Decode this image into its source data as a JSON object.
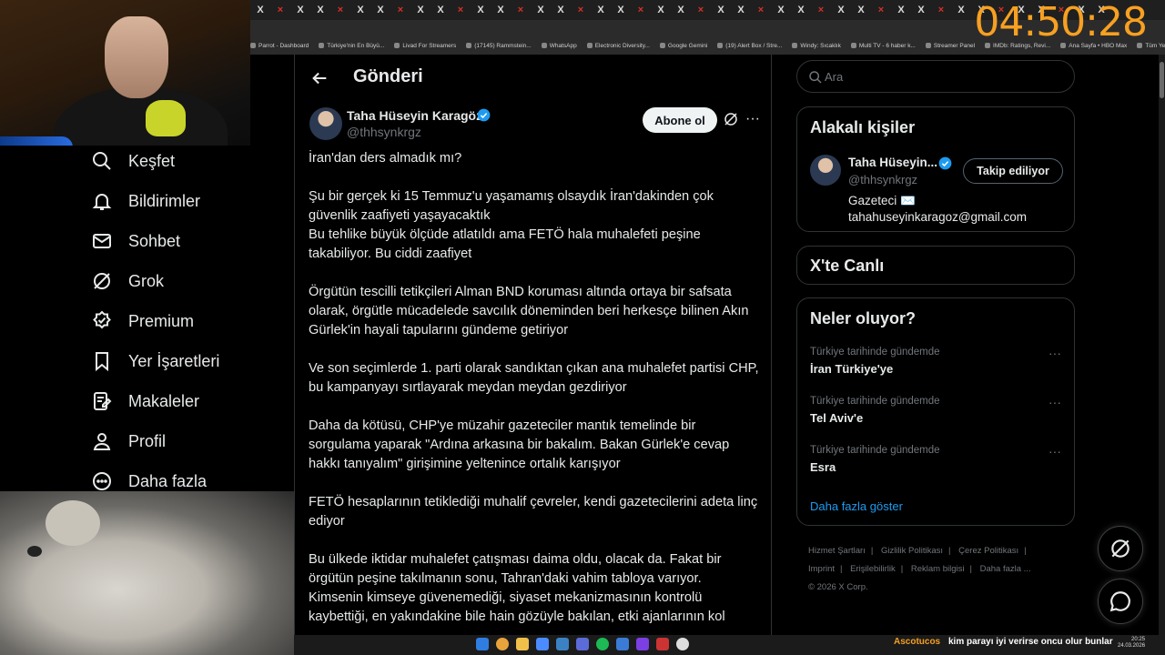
{
  "browser": {
    "tab_glyph": "X",
    "bookmarks": [
      "Parrot - Dashboard",
      "Türkiye'nin En Büyü...",
      "Livad For Streamers",
      "(17145) Rammstein...",
      "WhatsApp",
      "Electronic Diversity...",
      "Google Gemini",
      "(19) Alert Box / Stre...",
      "Windy: Sıcaklık",
      "Multi TV - 6 haber k...",
      "Streamer Panel",
      "IMDb: Ratings, Revi...",
      "Ana Sayfa • HBO Max",
      "Tüm Yer İşaretleri"
    ]
  },
  "overlay": {
    "clock": "04:50:28",
    "ticker_user": "Ascotucos",
    "ticker_message": "kim parayı iyi verirse oncu olur bunlar",
    "tray_time": "20:25",
    "tray_date": "24.03.2026"
  },
  "sidebar": {
    "items": [
      {
        "label": "Keşfet",
        "icon": "search-icon"
      },
      {
        "label": "Bildirimler",
        "icon": "bell-icon"
      },
      {
        "label": "Sohbet",
        "icon": "mail-icon"
      },
      {
        "label": "Grok",
        "icon": "grok-icon"
      },
      {
        "label": "Premium",
        "icon": "premium-icon"
      },
      {
        "label": "Yer İşaretleri",
        "icon": "bookmark-icon"
      },
      {
        "label": "Makaleler",
        "icon": "article-icon"
      },
      {
        "label": "Profil",
        "icon": "profile-icon"
      },
      {
        "label": "Daha fazla",
        "icon": "more-circle-icon"
      }
    ]
  },
  "post": {
    "header_title": "Gönderi",
    "author_name": "Taha Hüseyin Karagöz",
    "author_handle": "@thhsynkrgz",
    "subscribe_label": "Abone ol",
    "more_glyph": "···",
    "paragraphs": [
      "İran'dan ders almadık mı?",
      "Şu bir gerçek ki 15 Temmuz'u yaşamamış olsaydık İran'dakinden çok güvenlik zaafiyeti yaşayacaktık\nBu tehlike büyük ölçüde atlatıldı ama FETÖ hala muhalefeti peşine takabiliyor. Bu ciddi zaafiyet",
      "Örgütün tescilli tetikçileri Alman BND koruması altında ortaya bir safsata olarak, örgütle mücadelede savcılık döneminden beri herkesçe bilinen Akın Gürlek'in hayali tapularını gündeme getiriyor",
      "Ve son seçimlerde 1. parti olarak sandıktan çıkan ana muhalefet partisi CHP, bu kampanyayı sırtlayarak meydan meydan gezdiriyor",
      "Daha da kötüsü, CHP'ye müzahir gazeteciler mantık temelinde bir sorgulama yaparak \"Ardına arkasına bir bakalım. Bakan Gürlek'e cevap hakkı tanıyalım\" girişimine yeltenince ortalık karışıyor",
      "FETÖ hesaplarının tetiklediği muhalif çevreler, kendi gazetecilerini adeta linç ediyor",
      "Bu ülkede iktidar muhalefet çatışması daima oldu, olacak da. Fakat bir örgütün peşine takılmanın sonu, Tahran'daki vahim tabloya varıyor. Kimsenin kimseye güvenemediği, siyaset mekanizmasının kontrolü kaybettiği, en yakındakine bile hain gözüyle bakılan, etki ajanlarının kol"
    ]
  },
  "right": {
    "search_placeholder": "Ara",
    "related": {
      "title": "Alakalı kişiler",
      "name": "Taha Hüseyin...",
      "handle": "@thhsynkrgz",
      "follow_label": "Takip ediliyor",
      "bio_line1": "Gazeteci ✉️",
      "bio_line2": "tahahuseyinkaragoz@gmail.com"
    },
    "live": {
      "title": "X'te Canlı"
    },
    "trends": {
      "title": "Neler oluyor?",
      "items": [
        {
          "context": "Türkiye tarihinde gündemde",
          "title": "İran Türkiye'ye"
        },
        {
          "context": "Türkiye tarihinde gündemde",
          "title": "Tel Aviv'e"
        },
        {
          "context": "Türkiye tarihinde gündemde",
          "title": "Esra"
        }
      ],
      "show_more": "Daha fazla göster"
    },
    "footer": {
      "links": [
        "Hizmet Şartları",
        "|",
        "Gizlilik Politikası",
        "|",
        "Çerez Politikası",
        "|",
        "Imprint",
        "|",
        "Erişilebilirlik",
        "|",
        "Reklam bilgisi",
        "|",
        "Daha fazla ..."
      ],
      "copyright": "© 2026 X Corp."
    }
  },
  "colors": {
    "background": "#000000",
    "text": "#e7e9ea",
    "muted": "#71767b",
    "accent": "#1d9bf0",
    "border": "#2f3336",
    "clock": "#f7a021"
  }
}
